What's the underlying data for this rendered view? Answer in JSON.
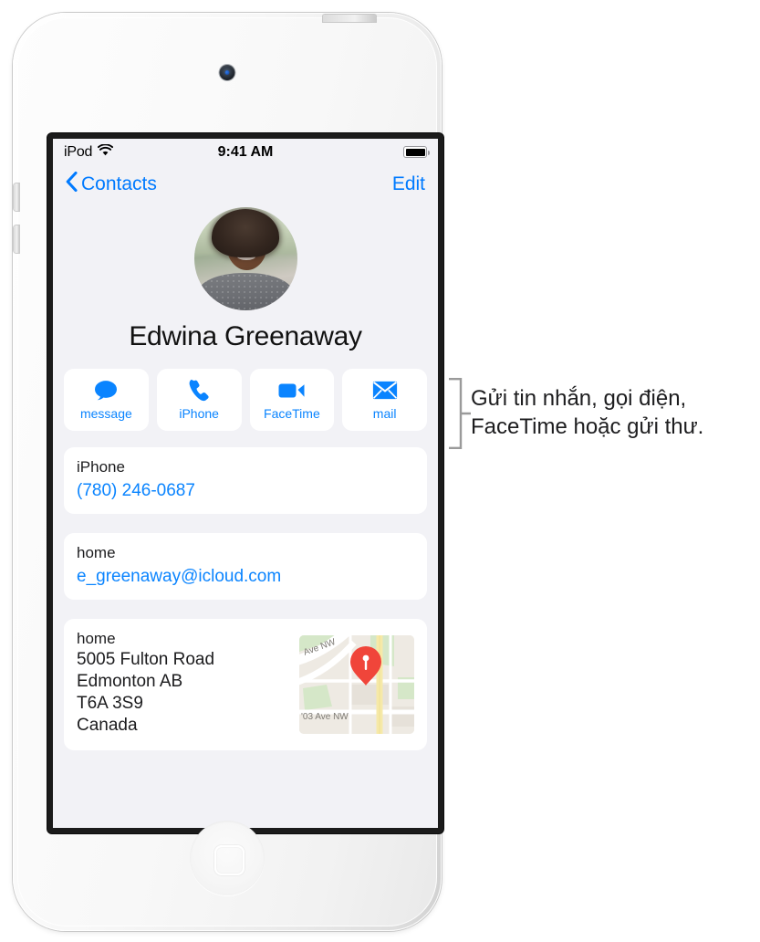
{
  "device": {
    "model_name": "iPod touch",
    "camera_icon": "front-camera",
    "home_button_icon": "home-square-icon"
  },
  "status_bar": {
    "carrier": "iPod",
    "wifi_icon": "wifi-icon",
    "time": "9:41 AM",
    "battery_icon": "battery-full-icon"
  },
  "nav_bar": {
    "back_icon": "chevron-left-icon",
    "back_label": "Contacts",
    "edit_label": "Edit",
    "tint_color": "#007aff"
  },
  "contact": {
    "avatar_alt": "contact-photo",
    "name": "Edwina Greenaway"
  },
  "actions": [
    {
      "icon": "message-bubble-icon",
      "label": "message"
    },
    {
      "icon": "phone-handset-icon",
      "label": "iPhone"
    },
    {
      "icon": "video-camera-icon",
      "label": "FaceTime"
    },
    {
      "icon": "envelope-icon",
      "label": "mail"
    }
  ],
  "fields": {
    "phone": {
      "label": "iPhone",
      "value": "(780) 246-0687"
    },
    "email": {
      "label": "home",
      "value": "e_greenaway@icloud.com"
    },
    "address": {
      "label": "home",
      "street": "5005 Fulton Road",
      "city_region": "Edmonton AB",
      "postal_code": "T6A 3S9",
      "country": "Canada",
      "map": {
        "pin_icon": "map-pin-icon",
        "pin_color": "#f0453a",
        "street_label_top": "Ave NW",
        "street_label_bottom": "'03 Ave NW"
      }
    }
  },
  "callout": {
    "text": "Gửi tin nhắn, gọi điện, FaceTime hoặc gửi thư.",
    "bracket_color": "#9a9a9a"
  },
  "colors": {
    "accent_blue": "#0a84ff",
    "nav_blue": "#007aff",
    "screen_background": "#f2f2f6",
    "card_background": "#ffffff",
    "text_primary": "#1c1c1e"
  }
}
